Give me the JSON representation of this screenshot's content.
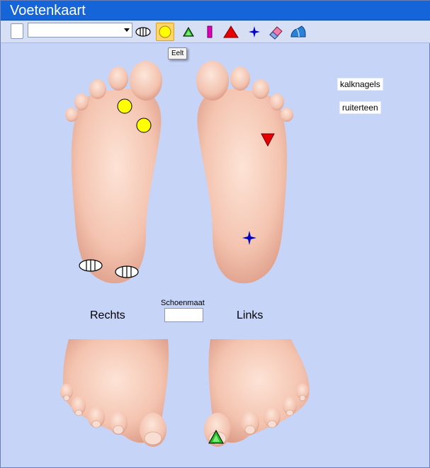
{
  "window": {
    "title": "Voetenkaart"
  },
  "toolbar": {
    "dropdown_value": "",
    "tools": [
      {
        "name": "blank-icon"
      },
      {
        "name": "stripes-oval-icon"
      },
      {
        "name": "yellow-circle-icon",
        "active": true
      },
      {
        "name": "green-triangle-icon"
      },
      {
        "name": "magenta-bar-icon"
      },
      {
        "name": "red-triangle-icon"
      },
      {
        "name": "blue-star-icon"
      },
      {
        "name": "eraser-icon"
      },
      {
        "name": "blue-shoe-icon"
      }
    ],
    "tooltip": "Eelt"
  },
  "labels": {
    "right": "Rechts",
    "left": "Links",
    "shoe_size_label": "Schoenmaat",
    "shoe_size_value": "",
    "tags": [
      "kalknagels",
      "ruiterteen"
    ]
  },
  "colors": {
    "titlebar": "#1565d8",
    "background": "#c6d4f8",
    "skin": "#f3c9b6",
    "yellow": "#ffff00",
    "red": "#e60000",
    "green": "#20c020",
    "blue": "#0000c0"
  }
}
